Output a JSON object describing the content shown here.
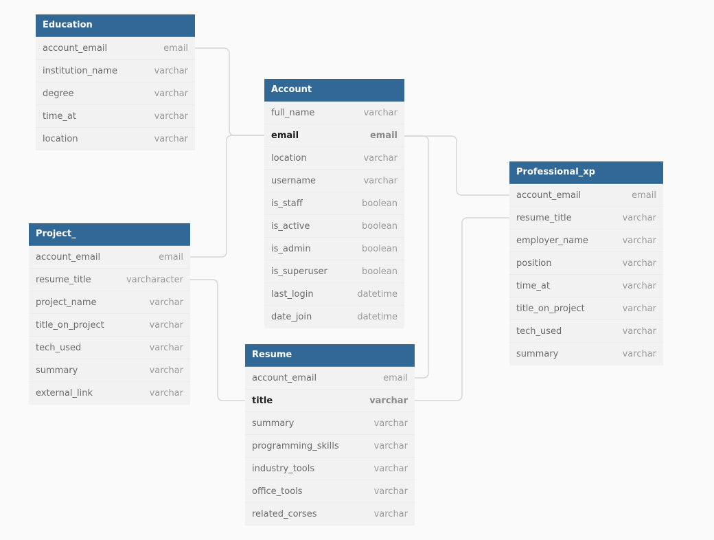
{
  "diagram": {
    "type": "entity-relationship",
    "tables": {
      "education": {
        "title": "Education",
        "columns": [
          {
            "name": "account_email",
            "type": "email"
          },
          {
            "name": "institution_name",
            "type": "varchar"
          },
          {
            "name": "degree",
            "type": "varchar"
          },
          {
            "name": "time_at",
            "type": "varchar"
          },
          {
            "name": "location",
            "type": "varchar"
          }
        ]
      },
      "account": {
        "title": "Account",
        "columns": [
          {
            "name": "full_name",
            "type": "varchar"
          },
          {
            "name": "email",
            "type": "email",
            "key": true
          },
          {
            "name": "location",
            "type": "varchar"
          },
          {
            "name": "username",
            "type": "varchar"
          },
          {
            "name": "is_staff",
            "type": "boolean"
          },
          {
            "name": "is_active",
            "type": "boolean"
          },
          {
            "name": "is_admin",
            "type": "boolean"
          },
          {
            "name": "is_superuser",
            "type": "boolean"
          },
          {
            "name": "last_login",
            "type": "datetime"
          },
          {
            "name": "date_join",
            "type": "datetime"
          }
        ]
      },
      "professional_xp": {
        "title": "Professional_xp",
        "columns": [
          {
            "name": "account_email",
            "type": "email"
          },
          {
            "name": "resume_title",
            "type": "varchar"
          },
          {
            "name": "employer_name",
            "type": "varchar"
          },
          {
            "name": "position",
            "type": "varchar"
          },
          {
            "name": "time_at",
            "type": "varchar"
          },
          {
            "name": "title_on_project",
            "type": "varchar"
          },
          {
            "name": "tech_used",
            "type": "varchar"
          },
          {
            "name": "summary",
            "type": "varchar"
          }
        ]
      },
      "project": {
        "title": "Project_",
        "columns": [
          {
            "name": "account_email",
            "type": "email"
          },
          {
            "name": "resume_title",
            "type": "varcharacter"
          },
          {
            "name": "project_name",
            "type": "varchar"
          },
          {
            "name": "title_on_project",
            "type": "varchar"
          },
          {
            "name": "tech_used",
            "type": "varchar"
          },
          {
            "name": "summary",
            "type": "varchar"
          },
          {
            "name": "external_link",
            "type": "varchar"
          }
        ]
      },
      "resume": {
        "title": "Resume",
        "columns": [
          {
            "name": "account_email",
            "type": "email"
          },
          {
            "name": "title",
            "type": "varchar",
            "key": true
          },
          {
            "name": "summary",
            "type": "varchar"
          },
          {
            "name": "programming_skills",
            "type": "varchar"
          },
          {
            "name": "industry_tools",
            "type": "varchar"
          },
          {
            "name": "office_tools",
            "type": "varchar"
          },
          {
            "name": "related_corses",
            "type": "varchar"
          }
        ]
      }
    },
    "relationships": [
      {
        "from": "Education.account_email",
        "to": "Account.email"
      },
      {
        "from": "Project_.account_email",
        "to": "Account.email"
      },
      {
        "from": "Account.email",
        "to": "Professional_xp.account_email"
      },
      {
        "from": "Account.email",
        "to": "Resume.account_email"
      },
      {
        "from": "Project_.resume_title",
        "to": "Resume.title"
      },
      {
        "from": "Resume.title",
        "to": "Professional_xp.resume_title"
      }
    ]
  }
}
